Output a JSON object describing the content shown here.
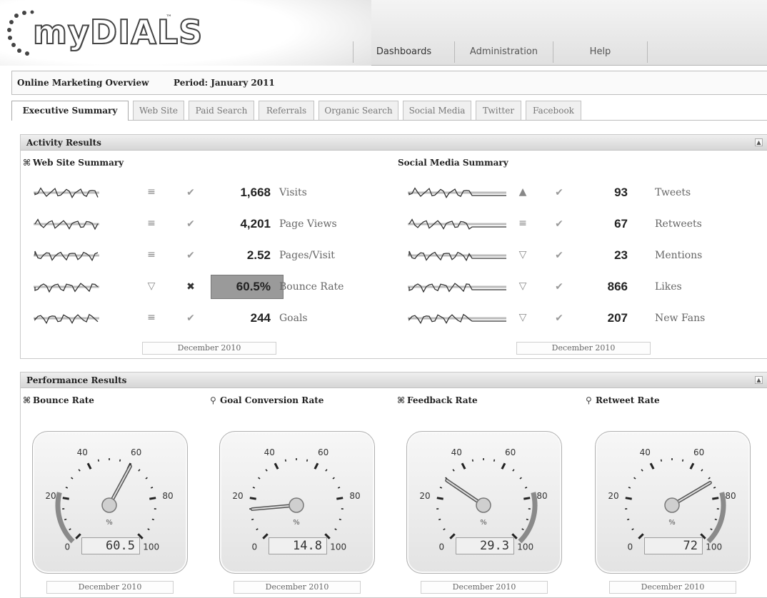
{
  "app": {
    "logo_text": "myDIALS",
    "logo_tm": "™"
  },
  "top_nav": [
    {
      "label": "Dashboards",
      "active": true
    },
    {
      "label": "Administration",
      "active": false
    },
    {
      "label": "Help",
      "active": false
    }
  ],
  "report": {
    "title": "Online Marketing Overview",
    "period": "Period: January 2011"
  },
  "tabs": [
    {
      "label": "Executive Summary",
      "active": true
    },
    {
      "label": "Web Site",
      "active": false
    },
    {
      "label": "Paid Search",
      "active": false
    },
    {
      "label": "Referrals",
      "active": false
    },
    {
      "label": "Organic Search",
      "active": false
    },
    {
      "label": "Social Media",
      "active": false
    },
    {
      "label": "Twitter",
      "active": false
    },
    {
      "label": "Facebook",
      "active": false
    }
  ],
  "activity": {
    "title": "Activity Results",
    "collapse_glyph": "▲",
    "web_site": {
      "title": "Web Site Summary",
      "icon": "alert-icon",
      "period": "December 2010",
      "rows": [
        {
          "value": "1,668",
          "label": "Visits",
          "trend": "flat",
          "status": "ok"
        },
        {
          "value": "4,201",
          "label": "Page Views",
          "trend": "flat",
          "status": "ok"
        },
        {
          "value": "2.52",
          "label": "Pages/Visit",
          "trend": "flat",
          "status": "ok"
        },
        {
          "value": "60.5%",
          "label": "Bounce Rate",
          "trend": "down",
          "status": "alert",
          "highlight": true
        },
        {
          "value": "244",
          "label": "Goals",
          "trend": "flat",
          "status": "ok"
        }
      ]
    },
    "social_media": {
      "title": "Social Media Summary",
      "period": "December 2010",
      "rows": [
        {
          "value": "93",
          "label": "Tweets",
          "trend": "up",
          "status": "ok"
        },
        {
          "value": "67",
          "label": "Retweets",
          "trend": "flat",
          "status": "ok"
        },
        {
          "value": "23",
          "label": "Mentions",
          "trend": "down",
          "status": "ok"
        },
        {
          "value": "866",
          "label": "Likes",
          "trend": "down",
          "status": "ok"
        },
        {
          "value": "207",
          "label": "New Fans",
          "trend": "down",
          "status": "ok"
        }
      ]
    }
  },
  "performance": {
    "title": "Performance Results",
    "collapse_glyph": "▲",
    "gauges": [
      {
        "title": "Bounce Rate",
        "icon": "alert-icon",
        "value": 60.5,
        "display": "60.5",
        "band": "low",
        "period": "December 2010"
      },
      {
        "title": "Goal Conversion Rate",
        "icon": "key-icon",
        "value": 14.8,
        "display": "14.8",
        "band": "none",
        "period": "December 2010"
      },
      {
        "title": "Feedback Rate",
        "icon": "alert-icon",
        "value": 29.3,
        "display": "29.3",
        "band": "high",
        "period": "December 2010"
      },
      {
        "title": "Retweet Rate",
        "icon": "key-icon",
        "value": 72,
        "display": "72",
        "band": "high",
        "period": "December 2010"
      }
    ],
    "scale": {
      "min": 0,
      "max": 100,
      "labels": [
        "0",
        "20",
        "40",
        "60",
        "80",
        "100"
      ],
      "unit": "%"
    }
  },
  "icons": {
    "trend_flat": "≡",
    "trend_up": "▲",
    "trend_down": "▽",
    "status_ok": "✔",
    "status_alert": "✖",
    "alert_icon_glyph": "⌘",
    "key_icon_glyph": "⚲"
  },
  "colors": {
    "text": "#222222",
    "muted": "#666666",
    "highlight": "#9a9a9a",
    "gauge_band": "#8a8a8a"
  }
}
